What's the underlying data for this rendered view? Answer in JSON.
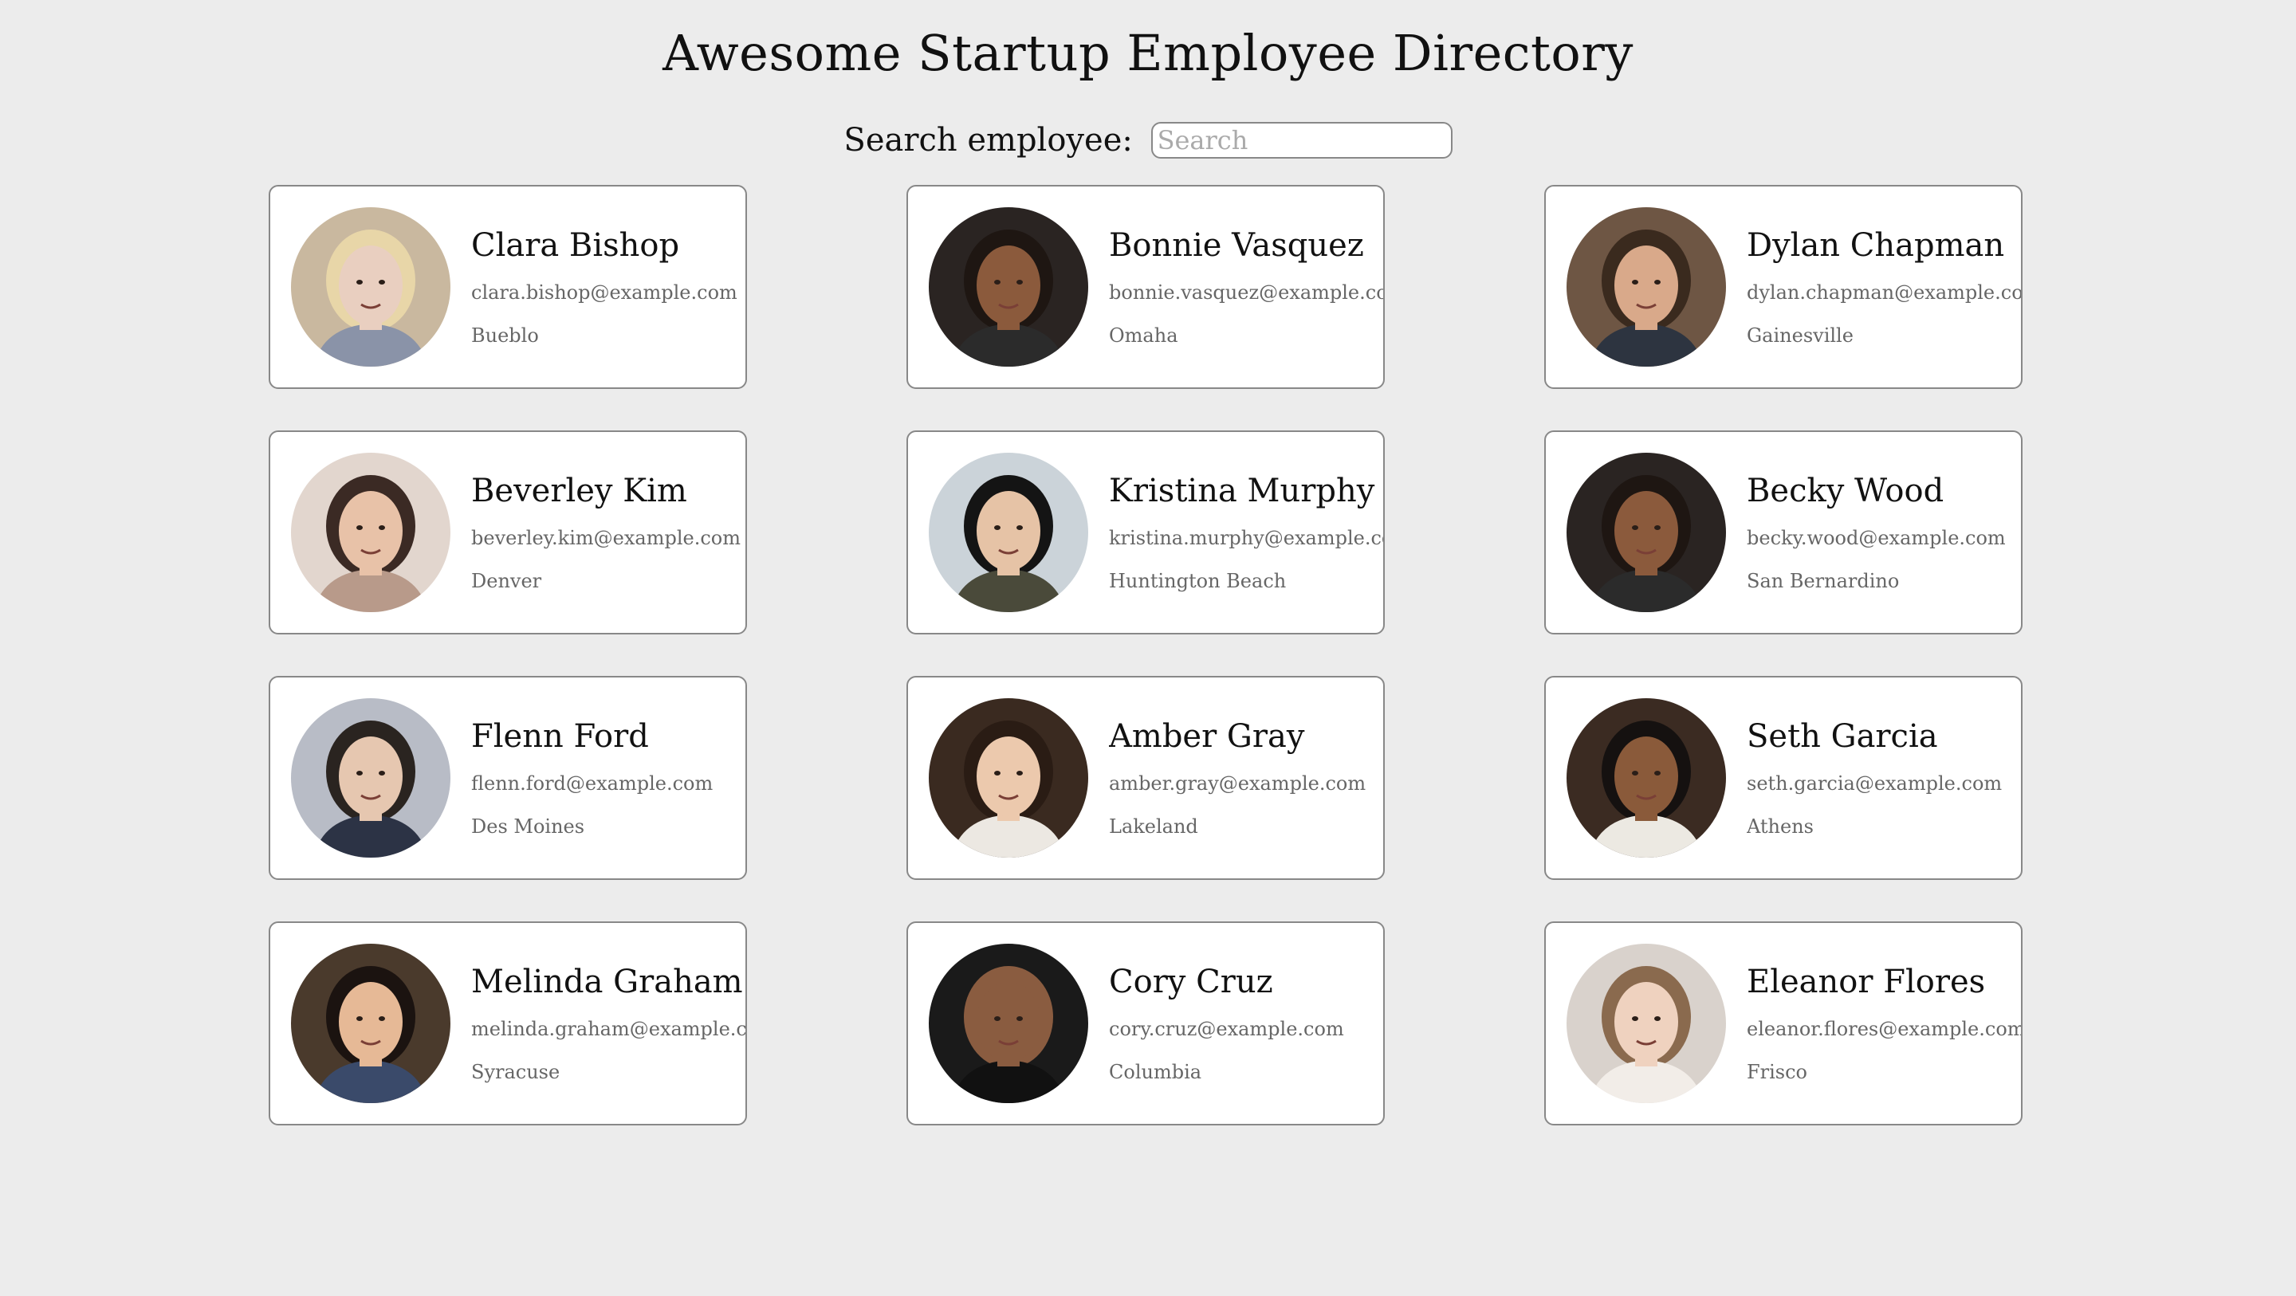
{
  "header": {
    "title": "Awesome Startup Employee Directory"
  },
  "search": {
    "label": "Search employee:",
    "placeholder": "Search",
    "value": ""
  },
  "employees": [
    {
      "name": "Clara Bishop",
      "email": "clara.bishop@example.com",
      "city": "Bueblo",
      "bg": "#c9b89f",
      "skin": "#e9cfc0",
      "hair": "#e8d6a8",
      "shirt": "#8a93a8"
    },
    {
      "name": "Bonnie Vasquez",
      "email": "bonnie.vasquez@example.com",
      "city": "Omaha",
      "bg": "#2a2422",
      "skin": "#8b5a3c",
      "hair": "#1e1612",
      "shirt": "#2b2b2b"
    },
    {
      "name": "Dylan Chapman",
      "email": "dylan.chapman@example.com",
      "city": "Gainesville",
      "bg": "#6e5644",
      "skin": "#d9a98a",
      "hair": "#3a2a1e",
      "shirt": "#2d3440"
    },
    {
      "name": "Beverley Kim",
      "email": "beverley.kim@example.com",
      "city": "Denver",
      "bg": "#e2d6ce",
      "skin": "#e8c2a8",
      "hair": "#3b2a24",
      "shirt": "#b89a8a"
    },
    {
      "name": "Kristina Murphy",
      "email": "kristina.murphy@example.com",
      "city": "Huntington Beach",
      "bg": "#cbd3d9",
      "skin": "#e6c3a6",
      "hair": "#141414",
      "shirt": "#4a4a3a"
    },
    {
      "name": "Becky Wood",
      "email": "becky.wood@example.com",
      "city": "San Bernardino",
      "bg": "#2a2422",
      "skin": "#8b5a3c",
      "hair": "#1e1612",
      "shirt": "#2b2b2b"
    },
    {
      "name": "Flenn Ford",
      "email": "flenn.ford@example.com",
      "city": "Des Moines",
      "bg": "#b8bcc6",
      "skin": "#e6c7b0",
      "hair": "#2a2420",
      "shirt": "#2c3345"
    },
    {
      "name": "Amber Gray",
      "email": "amber.gray@example.com",
      "city": "Lakeland",
      "bg": "#3a2a20",
      "skin": "#ecc9ad",
      "hair": "#2a1c14",
      "shirt": "#ece8e2"
    },
    {
      "name": "Seth Garcia",
      "email": "seth.garcia@example.com",
      "city": "Athens",
      "bg": "#3b2b22",
      "skin": "#8a5a3a",
      "hair": "#151110",
      "shirt": "#ece9e2"
    },
    {
      "name": "Melinda Graham",
      "email": "melinda.graham@example.com",
      "city": "Syracuse",
      "bg": "#4a3a2c",
      "skin": "#e6b996",
      "hair": "#1b1310",
      "shirt": "#3a4a6a"
    },
    {
      "name": "Cory Cruz",
      "email": "cory.cruz@example.com",
      "city": "Columbia",
      "bg": "#1a1a1a",
      "skin": "#8a5c40",
      "hair": "#8a5c40",
      "shirt": "#111111"
    },
    {
      "name": "Eleanor Flores",
      "email": "eleanor.flores@example.com",
      "city": "Frisco",
      "bg": "#d9d2cc",
      "skin": "#efd2bf",
      "hair": "#8a6a4e",
      "shirt": "#f2ede8"
    }
  ]
}
